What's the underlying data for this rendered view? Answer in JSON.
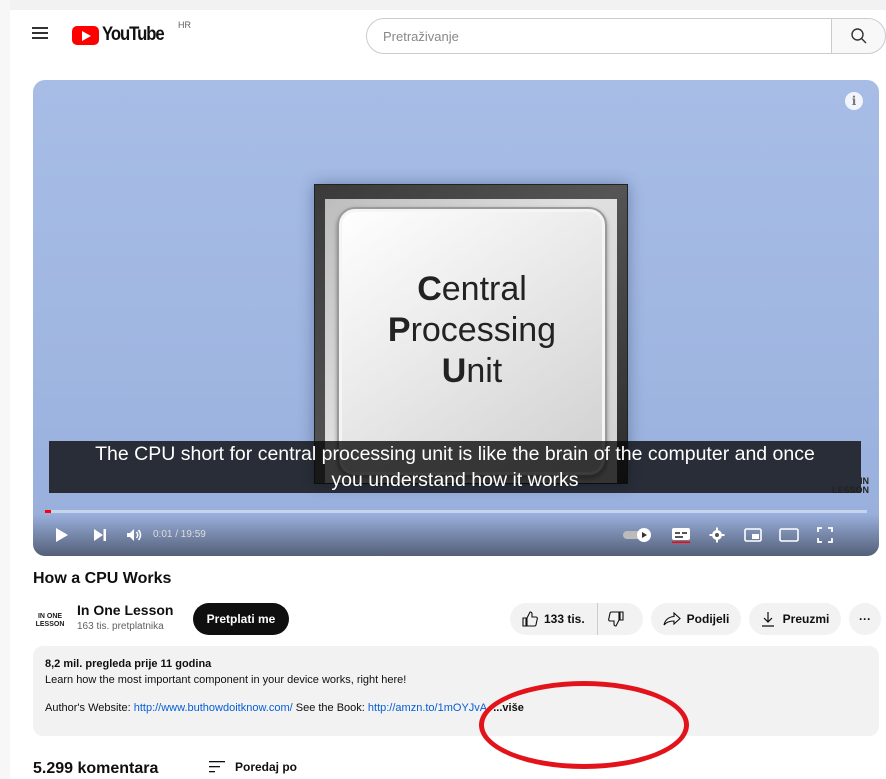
{
  "header": {
    "logo_text": "YouTube",
    "country_code": "HR",
    "search_placeholder": "Pretraživanje"
  },
  "player": {
    "thumbnail_line1_first": "C",
    "thumbnail_line1_rest": "entral",
    "thumbnail_line2_first": "P",
    "thumbnail_line2_rest": "rocessing",
    "thumbnail_line3_first": "U",
    "thumbnail_line3_rest": "nit",
    "caption_line1": "The CPU short for central processing unit is like the brain of the computer and once",
    "caption_line2": "you understand how it works",
    "watermark_line1": "IN",
    "watermark_line2": "LESSON",
    "time_display": "0:01 / 19:59",
    "progress_fraction": 0.001,
    "info_label": "i"
  },
  "video": {
    "title": "How a CPU Works"
  },
  "channel": {
    "avatar_line1": "IN ONE",
    "avatar_line2": "LESSON",
    "name": "In One Lesson",
    "subscribers": "163 tis. pretplatnika",
    "subscribe_label": "Pretplati me"
  },
  "actions": {
    "like_count": "133 tis.",
    "share_label": "Podijeli",
    "download_label": "Preuzmi",
    "more_label": "···"
  },
  "description": {
    "meta": "8,2 mil. pregleda  prije 11 godina",
    "line1": "Learn how the most important component in your device works, right here!",
    "website_prefix": "Author's Website: ",
    "website_link": "http://www.buthowdoitknow.com/",
    "book_prefix": " See the Book: ",
    "book_link": "http://amzn.to/1mOYJvA",
    "more_label": "...više"
  },
  "comments": {
    "count_label": "5.299 komentara",
    "sort_label": "Poredaj po"
  },
  "colors": {
    "brand_red": "#ff0000",
    "link_blue": "#065fd4",
    "annotation_red": "#e3131b"
  }
}
